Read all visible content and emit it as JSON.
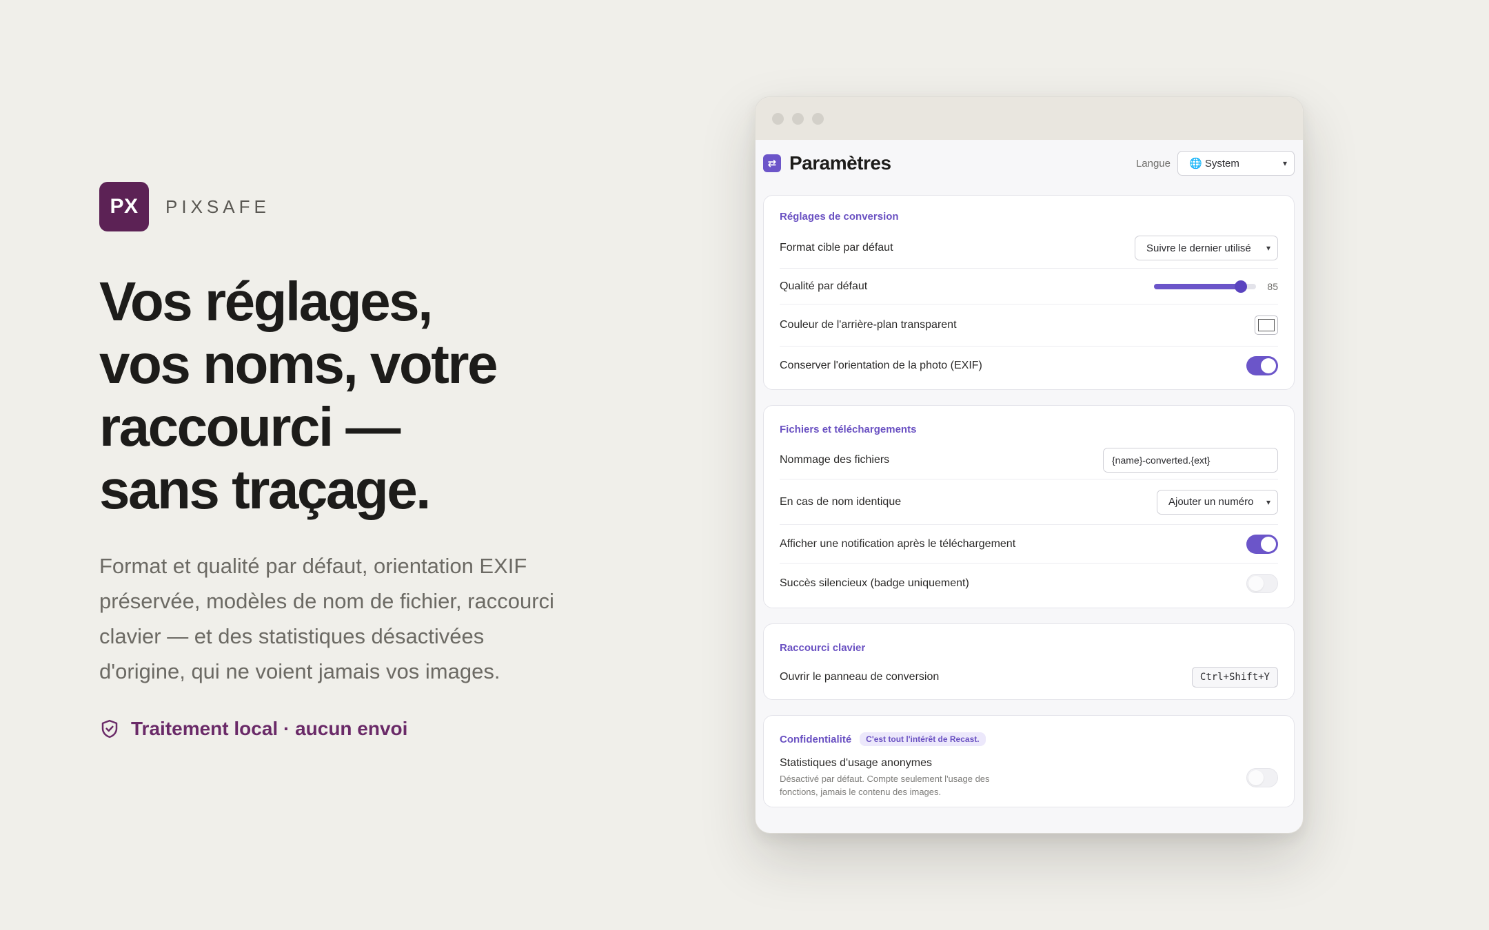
{
  "brand": {
    "logo_text": "PX",
    "name": "PIXSAFE",
    "logo_color": "#5c2255"
  },
  "hero": {
    "headline": [
      "Vos réglages,",
      "vos noms, votre",
      "raccourci —",
      "sans traçage."
    ],
    "subtitle": [
      "Format et qualité par défaut, orientation EXIF",
      "préservée, modèles de nom de fichier, raccourci",
      "clavier — et des statistiques désactivées",
      "d'origine, qui ne voient jamais vos images."
    ],
    "trust_icon": "shield-check-icon",
    "trust_text": "Traitement local · aucun envoi"
  },
  "window": {
    "title": "Paramètres",
    "app_icon": "⇄",
    "language": {
      "label": "Langue",
      "value": "🌐 System"
    },
    "accent": "#6b55c9",
    "sections": {
      "conversion": {
        "title": "Réglages de conversion",
        "format_label": "Format cible par défaut",
        "format_value": "Suivre le dernier utilisé",
        "quality_label": "Qualité par défaut",
        "quality_value": "85",
        "quality_fraction": 0.85,
        "bg_color_label": "Couleur de l'arrière-plan transparent",
        "bg_color_value": "#ffffff",
        "exif_label": "Conserver l'orientation de la photo (EXIF)",
        "exif_on": true
      },
      "files": {
        "title": "Fichiers et téléchargements",
        "naming_label": "Nommage des fichiers",
        "naming_value": "{name}-converted.{ext}",
        "conflict_label": "En cas de nom identique",
        "conflict_value": "Ajouter un numéro",
        "notify_label": "Afficher une notification après le téléchargement",
        "notify_on": true,
        "silent_label": "Succès silencieux (badge uniquement)",
        "silent_on": false
      },
      "shortcut": {
        "title": "Raccourci clavier",
        "open_label": "Ouvrir le panneau de conversion",
        "open_keys": "Ctrl+Shift+Y"
      },
      "privacy": {
        "title": "Confidentialité",
        "badge": "C'est tout l'intérêt de Recast.",
        "stats_label": "Statistiques d'usage anonymes",
        "stats_desc_1": "Désactivé par défaut. Compte seulement l'usage des",
        "stats_desc_2": "fonctions, jamais le contenu des images.",
        "stats_on": false
      }
    }
  }
}
